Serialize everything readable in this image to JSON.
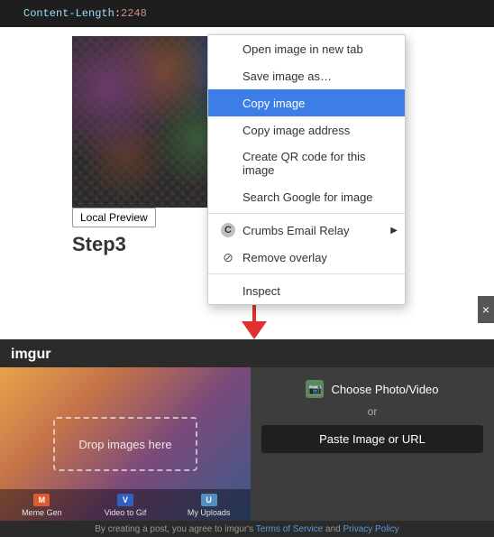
{
  "code": {
    "indent": "    ",
    "property": "Content-Length",
    "value": "2248"
  },
  "image": {
    "alt": "Pixel art image"
  },
  "local_preview_button": {
    "label": "Local Preview"
  },
  "step_heading": {
    "text": "Step3"
  },
  "context_menu": {
    "items": [
      {
        "id": "open-new-tab",
        "label": "Open image in new tab",
        "icon": "",
        "hasSubmenu": false,
        "highlighted": false
      },
      {
        "id": "save-image",
        "label": "Save image as…",
        "icon": "",
        "hasSubmenu": false,
        "highlighted": false
      },
      {
        "id": "copy-image",
        "label": "Copy image",
        "icon": "",
        "hasSubmenu": false,
        "highlighted": true
      },
      {
        "id": "copy-address",
        "label": "Copy image address",
        "icon": "",
        "hasSubmenu": false,
        "highlighted": false
      },
      {
        "id": "create-qr",
        "label": "Create QR code for this image",
        "icon": "",
        "hasSubmenu": false,
        "highlighted": false
      },
      {
        "id": "search-google",
        "label": "Search Google for image",
        "icon": "",
        "hasSubmenu": false,
        "highlighted": false
      },
      {
        "id": "crumbs-relay",
        "label": "Crumbs Email Relay",
        "icon": "C",
        "hasSubmenu": true,
        "highlighted": false
      },
      {
        "id": "remove-overlay",
        "label": "Remove overlay",
        "icon": "⊘",
        "hasSubmenu": false,
        "highlighted": false
      },
      {
        "id": "inspect",
        "label": "Inspect",
        "icon": "",
        "hasSubmenu": false,
        "highlighted": false
      }
    ]
  },
  "imgur": {
    "brand": "imgur",
    "drop_zone_text": "Drop images here",
    "or_text": "or",
    "choose_photo_label": "Choose Photo/Video",
    "paste_label": "Paste Image or URL",
    "bottom_icons": [
      {
        "id": "meme-gen",
        "label": "Meme Gen",
        "color": "#e05a30"
      },
      {
        "id": "video-to-gif",
        "label": "Video to Gif",
        "color": "#3060c0"
      },
      {
        "id": "my-uploads",
        "label": "My Uploads",
        "color": "#5090c0"
      }
    ],
    "footer": {
      "text_prefix": "By creating a post, you agree to imgur's ",
      "tos_label": "Terms of Service",
      "and_text": " and ",
      "privacy_label": "Privacy Policy"
    }
  },
  "close_button": {
    "label": "×"
  }
}
